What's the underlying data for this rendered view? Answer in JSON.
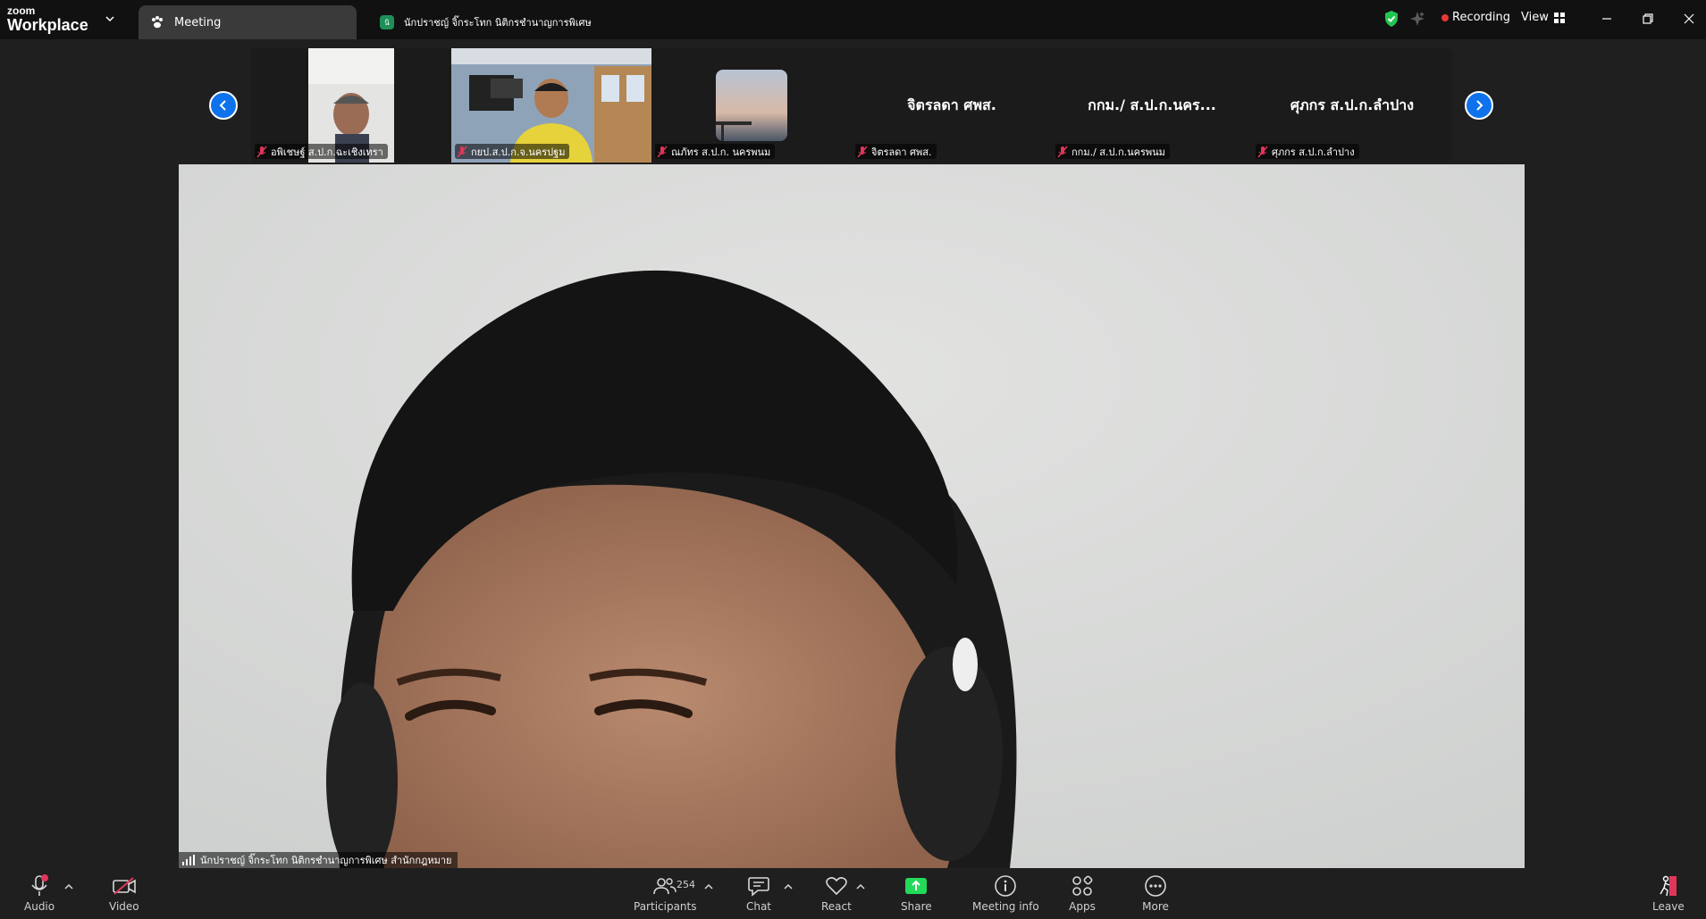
{
  "app": {
    "brand_top": "zoom",
    "brand_bottom": "Workplace"
  },
  "tabs": [
    {
      "label": "Meeting"
    },
    {
      "label": "นักปราชญ์ จิ๊กระโทก นิติกรชำนาญการพิเศษ",
      "badge": "นิ"
    }
  ],
  "status": {
    "recording_label": "Recording",
    "view_label": "View"
  },
  "thumbnails": [
    {
      "name": "อพิเชษฐ์ ส.ป.ก.ฉะเชิงเทรา",
      "type": "video"
    },
    {
      "name": "กยป.ส.ป.ก.จ.นครปฐม",
      "type": "video"
    },
    {
      "name": "ณภัทร ส.ป.ก. นครพนม",
      "type": "photo"
    },
    {
      "name": "จิตรลดา ศพส.",
      "display": "จิตรลดา ศพส.",
      "type": "name"
    },
    {
      "name": "กกม./ ส.ป.ก.นครพนม",
      "display": "กกม./ ส.ป.ก.นคร...",
      "type": "name"
    },
    {
      "name": "ศุภกร ส.ป.ก.ลำปาง",
      "display": "ศุภกร ส.ป.ก.ลำปาง",
      "type": "name"
    }
  ],
  "main_speaker": {
    "name": "นักปราชญ์ จิ๊กระโทก นิติกรชำนาญการพิเศษ สำนักกฎหมาย"
  },
  "toolbar": {
    "audio": "Audio",
    "video": "Video",
    "participants": "Participants",
    "participants_count": "254",
    "chat": "Chat",
    "react": "React",
    "share": "Share",
    "meeting_info": "Meeting info",
    "apps": "Apps",
    "more": "More",
    "leave": "Leave"
  },
  "colors": {
    "accent_blue": "#0e72ed",
    "share_green": "#23d959",
    "recording_red": "#e53935",
    "mute_red": "#e0365a"
  },
  "icons": {
    "security": "shield-check-icon",
    "ai": "sparkle-icon"
  }
}
